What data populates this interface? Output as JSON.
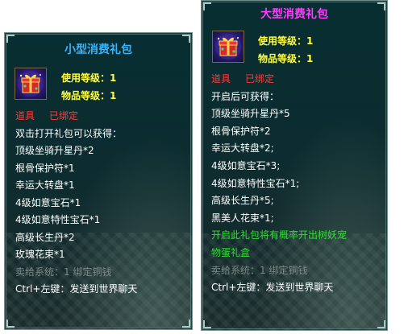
{
  "small_tooltip": {
    "title": "小型消费礼包",
    "use_level": "使用等级：1",
    "item_level": "物品等级：1",
    "type_label": "道具",
    "bind_label": "已绑定",
    "lines": [
      "双击打开礼包可以获得：",
      "顶级坐骑升星丹*2",
      "根骨保护符*1",
      "幸运大转盘*1",
      "4级如意宝石*1",
      "4级如意特性宝石*1",
      "高级长生丹*2",
      "玫瑰花束*1"
    ],
    "sell_info": "卖给系统：1 绑定铜钱",
    "hint": "Ctrl+左键：发送到世界聊天",
    "icon": "gift-box-icon"
  },
  "large_tooltip": {
    "title": "大型消费礼包",
    "use_level": "使用等级：1",
    "item_level": "物品等级：1",
    "type_label": "道具",
    "bind_label": "已绑定",
    "lines": [
      "开启后可获得：",
      "顶级坐骑升星丹*5",
      "根骨保护符*2",
      "幸运大转盘*2;",
      "4级如意宝石*3;",
      "4级如意特性宝石*1;",
      "高级长生丹*5;",
      "黑美人花束*1;"
    ],
    "special_line_1": "开启此礼包将有概率开出树妖宠",
    "special_line_2": "物蛋礼盒",
    "sell_info": "卖给系统：1 绑定铜钱",
    "hint": "Ctrl+左键：发送到世界聊天",
    "icon": "gift-box-icon"
  },
  "colors": {
    "small_title": "#35b4ff",
    "large_title": "#ff3cff",
    "level_text": "#ffff3c",
    "bind_text": "#ff3c3c",
    "special_text": "#2fe02f",
    "sell_text": "#7e8b88",
    "body_text": "#ffffff"
  }
}
